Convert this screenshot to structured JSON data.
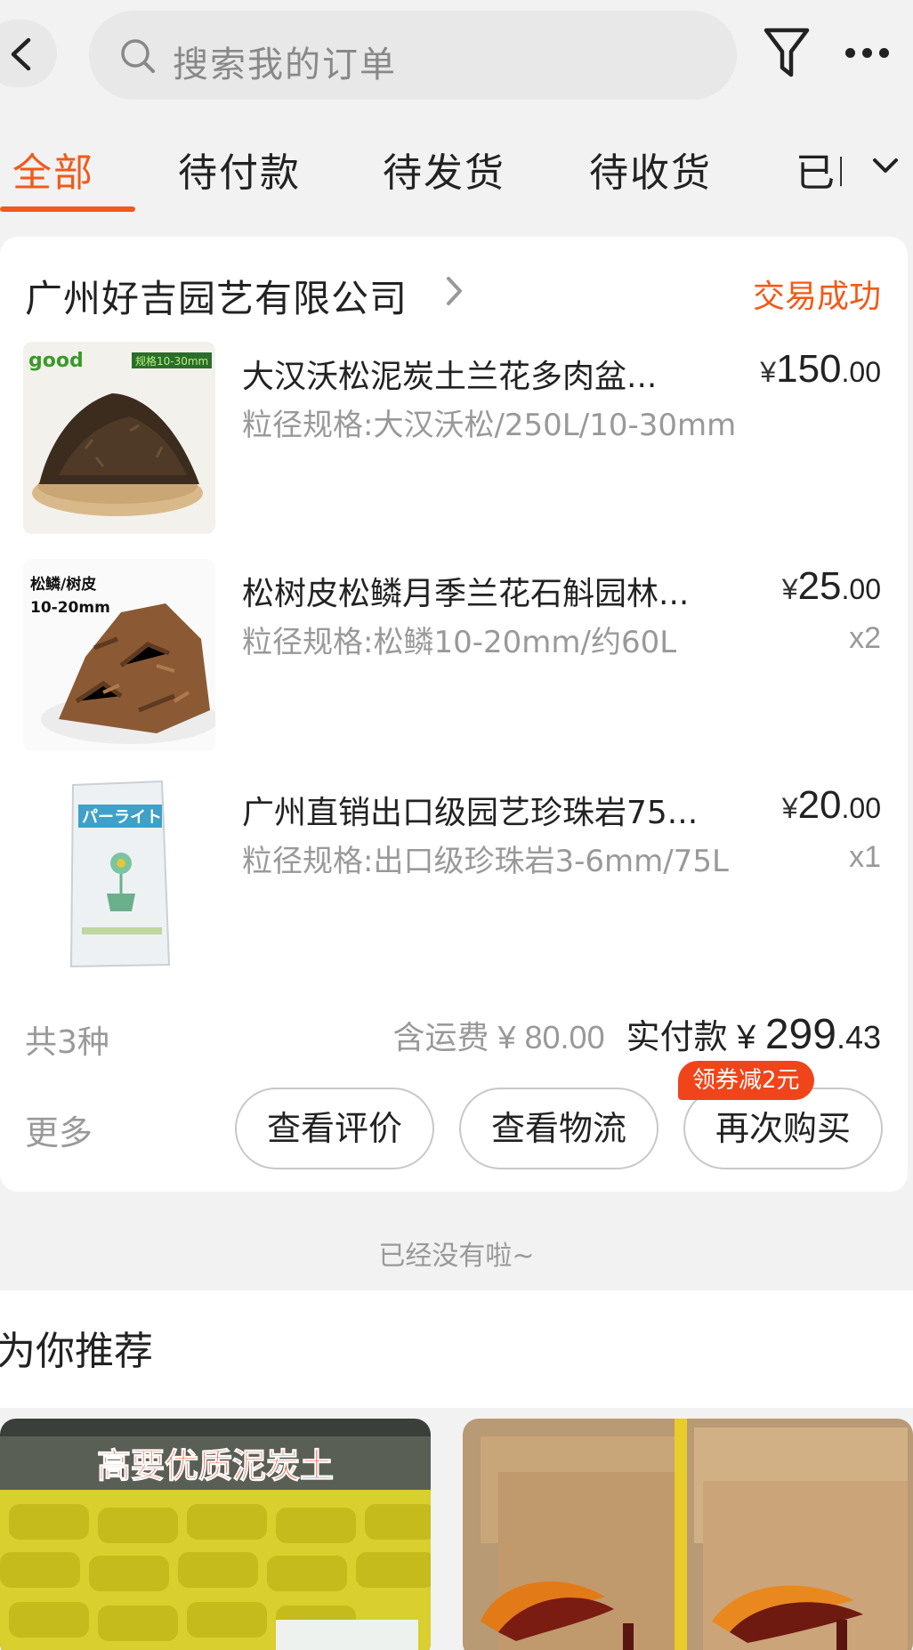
{
  "search": {
    "placeholder": "搜索我的订单"
  },
  "icons": {
    "back": "chevron-left-icon",
    "search": "search-icon",
    "filter": "filter-icon",
    "more": "more-icon",
    "tab_expand": "chevron-down-icon",
    "shop_arrow": "chevron-right-icon"
  },
  "tabs": [
    {
      "label": "全部",
      "active": true
    },
    {
      "label": "待付款",
      "active": false
    },
    {
      "label": "待发货",
      "active": false
    },
    {
      "label": "待收货",
      "active": false
    },
    {
      "label": "已l",
      "active": false
    }
  ],
  "order": {
    "shop_name": "广州好吉园艺有限公司",
    "status": "交易成功",
    "items": [
      {
        "title": "大汉沃松泥炭土兰花多肉盆...",
        "spec": "粒径规格:大汉沃松/250L/10-30mm",
        "currency": "¥",
        "price_int": "150",
        "price_dec": ".00",
        "qty": "",
        "image_text": "good",
        "image_badge": "规格10-30mm"
      },
      {
        "title": "松树皮松鳞月季兰花石斛园林...",
        "spec": "粒径规格:松鳞10-20mm/约60L",
        "currency": "¥",
        "price_int": "25",
        "price_dec": ".00",
        "qty": "x2",
        "image_text": "松鳞/树皮",
        "image_badge": "10-20mm"
      },
      {
        "title": "广州直销出口级园艺珍珠岩75...",
        "spec": "粒径规格:出口级珍珠岩3-6mm/75L",
        "currency": "¥",
        "price_int": "20",
        "price_dec": ".00",
        "qty": "x1",
        "image_text": "パーライト",
        "image_badge": ""
      }
    ],
    "summary": {
      "count": "共3种",
      "shipping_label": "含运费 ¥ 80.00",
      "paid_label": "实付款 ¥ ",
      "paid_int": "299",
      "paid_dec": ".43"
    },
    "more_label": "更多",
    "buttons": {
      "review": "查看评价",
      "logistics": "查看物流",
      "rebuy": "再次购买"
    },
    "coupon_tag": "领券减2元"
  },
  "footer": {
    "no_more": "已经没有啦~"
  },
  "recommend": {
    "title": "为你推荐",
    "cards": [
      {
        "banner_text": "高要优质泥炭土"
      },
      {
        "banner_text": ""
      }
    ]
  },
  "colors": {
    "accent": "#f05a1a",
    "coupon": "#f0451a",
    "muted": "#999999",
    "background": "#f2f2f2"
  }
}
